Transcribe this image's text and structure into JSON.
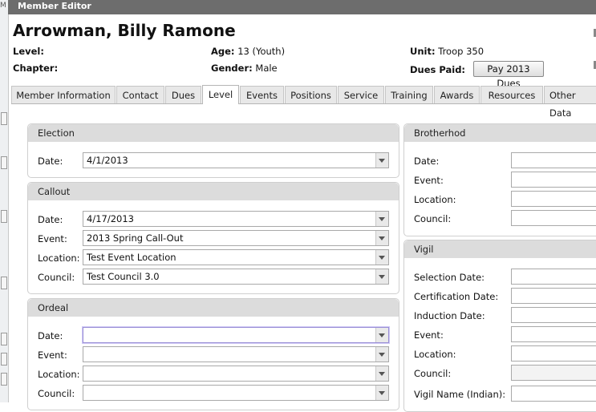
{
  "window": {
    "title": "Member Editor"
  },
  "member": {
    "name": "Arrowman, Billy Ramone",
    "level_label": "Level:",
    "chapter_label": "Chapter:",
    "age_label": "Age:",
    "age_value": "13 (Youth)",
    "gender_label": "Gender:",
    "gender_value": "Male",
    "unit_label": "Unit:",
    "unit_value": "Troop 350",
    "dues_label": "Dues Paid:",
    "pay_button": "Pay 2013 Dues"
  },
  "tabs": [
    "Member Information",
    "Contact",
    "Dues",
    "Level",
    "Events",
    "Positions",
    "Service",
    "Training",
    "Awards",
    "Resources",
    "Other Data"
  ],
  "active_tab": "Level",
  "election": {
    "title": "Election",
    "date_label": "Date:",
    "date_value": "4/1/2013"
  },
  "callout": {
    "title": "Callout",
    "date_label": "Date:",
    "date_value": "4/17/2013",
    "event_label": "Event:",
    "event_value": "2013 Spring Call-Out",
    "location_label": "Location:",
    "location_value": "Test Event Location",
    "council_label": "Council:",
    "council_value": "Test Council 3.0"
  },
  "ordeal": {
    "title": "Ordeal",
    "date_label": "Date:",
    "event_label": "Event:",
    "location_label": "Location:",
    "council_label": "Council:"
  },
  "brotherhood": {
    "title": "Brotherhod",
    "date_label": "Date:",
    "event_label": "Event:",
    "location_label": "Location:",
    "council_label": "Council:"
  },
  "vigil": {
    "title": "Vigil",
    "selection_label": "Selection Date:",
    "certification_label": "Certification Date:",
    "induction_label": "Induction Date:",
    "event_label": "Event:",
    "location_label": "Location:",
    "council_label": "Council:",
    "name_label": "Vigil Name (Indian):"
  }
}
